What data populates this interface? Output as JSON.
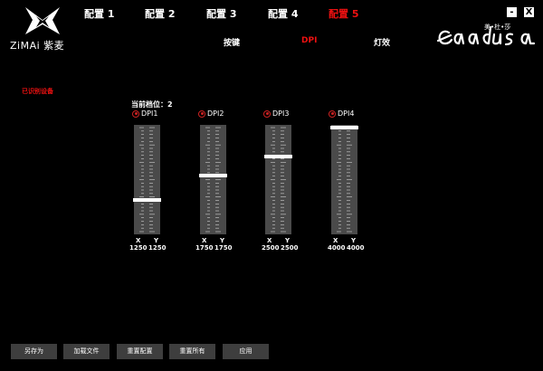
{
  "logo": {
    "text": "ZiMAi 紫麦"
  },
  "profile_tabs": [
    {
      "label": "配置 1",
      "active": false
    },
    {
      "label": "配置 2",
      "active": false
    },
    {
      "label": "配置 3",
      "active": false
    },
    {
      "label": "配置 4",
      "active": false
    },
    {
      "label": "配置 5",
      "active": true
    }
  ],
  "sub_tabs": [
    {
      "label": "按键",
      "active": false
    },
    {
      "label": "DPI",
      "active": true
    },
    {
      "label": "灯效",
      "active": false
    }
  ],
  "window_controls": {
    "minimize": "-",
    "close": "X"
  },
  "brand": {
    "sub": "美•杜•莎"
  },
  "device_status": "已识别设备",
  "current_level": "当前档位：2",
  "dpi_levels": [
    {
      "name": "DPI1",
      "x_label": "X",
      "y_label": "Y",
      "x": "1250",
      "y": "1250",
      "fraction": 0.31
    },
    {
      "name": "DPI2",
      "x_label": "X",
      "y_label": "Y",
      "x": "1750",
      "y": "1750",
      "fraction": 0.54
    },
    {
      "name": "DPI3",
      "x_label": "X",
      "y_label": "Y",
      "x": "2500",
      "y": "2500",
      "fraction": 0.72
    },
    {
      "name": "DPI4",
      "x_label": "X",
      "y_label": "Y",
      "x": "4000",
      "y": "4000",
      "fraction": 0.99
    }
  ],
  "buttons": {
    "save_as": "另存为",
    "load_file": "加载文件",
    "reset_config": "重置配置",
    "reset_all": "重置所有",
    "apply": "应用"
  },
  "colors": {
    "accent": "#ee1111",
    "track": "#4a4a4a",
    "button": "#3e3e3e"
  }
}
